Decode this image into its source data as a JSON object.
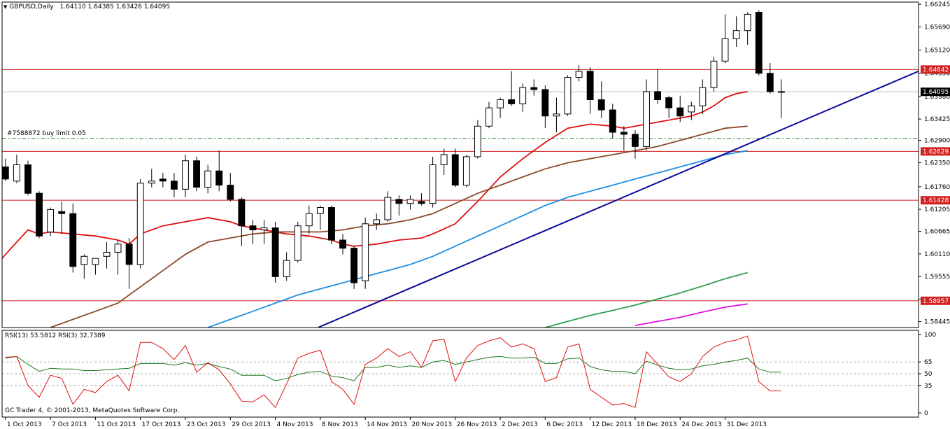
{
  "window": {
    "symbol_label": "GBPUSD,Daily",
    "ohlc_label": "1.64110 1.64385 1.63426 1.64095",
    "rsi_label": "RSI(13) 53.5812  RSI(3) 32.7389",
    "copyright": "GC Trader 4, © 2001-2013, MetaQuotes Software Corp."
  },
  "colors": {
    "candle_outline": "#000000",
    "bear_fill": "#000000",
    "bull_fill": "#ffffff",
    "ma_fast": "#e01010",
    "ma_mid": "#8b4a2b",
    "ma_slow": "#1e8fe0",
    "ma_200": "#2e9e50",
    "ma_300": "#e010e0",
    "trendline": "#0a0a9a",
    "level_line": "#d02020",
    "current_price_line": "#c0c0c0",
    "order_line": "#2a8a2a",
    "rsi_fast": "#e01010",
    "rsi_slow": "#1a7a1a"
  },
  "chart_data": {
    "type": "candlestick",
    "y_range": [
      1.583,
      1.663
    ],
    "x_range": [
      -0.3,
      81.2
    ],
    "grid": false,
    "price_ticks": [
      "1.66245",
      "1.65690",
      "1.65120",
      "1.64550",
      "1.63980",
      "1.63425",
      "1.62900",
      "1.62350",
      "1.61760",
      "1.61205",
      "1.60665",
      "1.60110",
      "1.59555",
      "1.59000",
      "1.58445"
    ],
    "date_ticks": [
      {
        "i": 0,
        "label": "1 Oct 2013"
      },
      {
        "i": 4,
        "label": "7 Oct 2013"
      },
      {
        "i": 8,
        "label": "11 Oct 2013"
      },
      {
        "i": 12,
        "label": "17 Oct 2013"
      },
      {
        "i": 16,
        "label": "23 Oct 2013"
      },
      {
        "i": 20,
        "label": "29 Oct 2013"
      },
      {
        "i": 24,
        "label": "4 Nov 2013"
      },
      {
        "i": 28,
        "label": "8 Nov 2013"
      },
      {
        "i": 32,
        "label": "14 Nov 2013"
      },
      {
        "i": 36,
        "label": "20 Nov 2013"
      },
      {
        "i": 40,
        "label": "26 Nov 2013"
      },
      {
        "i": 44,
        "label": "2 Dec 2013"
      },
      {
        "i": 48,
        "label": "6 Dec 2013"
      },
      {
        "i": 52,
        "label": "12 Dec 2013"
      },
      {
        "i": 56,
        "label": "18 Dec 2013"
      },
      {
        "i": 60,
        "label": "24 Dec 2013"
      },
      {
        "i": 64,
        "label": "31 Dec 2013"
      }
    ],
    "candles": [
      [
        1.6225,
        1.6245,
        1.619,
        1.6195
      ],
      [
        1.619,
        1.6255,
        1.6185,
        1.623
      ],
      [
        1.623,
        1.624,
        1.6155,
        1.616
      ],
      [
        1.616,
        1.6165,
        1.605,
        1.6055
      ],
      [
        1.6065,
        1.6125,
        1.6055,
        1.612
      ],
      [
        1.6115,
        1.614,
        1.606,
        1.611
      ],
      [
        1.611,
        1.6135,
        1.5965,
        1.598
      ],
      [
        1.5985,
        1.601,
        1.595,
        1.6005
      ],
      [
        1.5985,
        1.6,
        1.596,
        1.6
      ],
      [
        1.6005,
        1.604,
        1.5975,
        1.6015
      ],
      [
        1.6015,
        1.6045,
        1.596,
        1.6035
      ],
      [
        1.6035,
        1.605,
        1.5925,
        1.5985
      ],
      [
        1.5985,
        1.6195,
        1.5975,
        1.6185
      ],
      [
        1.6185,
        1.622,
        1.6175,
        1.619
      ],
      [
        1.6195,
        1.621,
        1.6175,
        1.619
      ],
      [
        1.619,
        1.621,
        1.615,
        1.617
      ],
      [
        1.617,
        1.6255,
        1.615,
        1.624
      ],
      [
        1.624,
        1.625,
        1.6165,
        1.6175
      ],
      [
        1.6175,
        1.623,
        1.616,
        1.6215
      ],
      [
        1.6215,
        1.6265,
        1.6165,
        1.618
      ],
      [
        1.618,
        1.621,
        1.614,
        1.6145
      ],
      [
        1.6145,
        1.615,
        1.603,
        1.608
      ],
      [
        1.608,
        1.6095,
        1.6035,
        1.607
      ],
      [
        1.607,
        1.6095,
        1.6035,
        1.6075
      ],
      [
        1.6075,
        1.609,
        1.594,
        1.5955
      ],
      [
        1.5955,
        1.6015,
        1.5945,
        1.5995
      ],
      [
        1.5995,
        1.609,
        1.599,
        1.608
      ],
      [
        1.608,
        1.613,
        1.606,
        1.611
      ],
      [
        1.611,
        1.613,
        1.607,
        1.6125
      ],
      [
        1.6125,
        1.613,
        1.6035,
        1.6045
      ],
      [
        1.6045,
        1.606,
        1.601,
        1.6025
      ],
      [
        1.6025,
        1.603,
        1.5925,
        1.594
      ],
      [
        1.5945,
        1.61,
        1.5925,
        1.6085
      ],
      [
        1.6085,
        1.611,
        1.607,
        1.6095
      ],
      [
        1.6095,
        1.6165,
        1.609,
        1.615
      ],
      [
        1.6145,
        1.6155,
        1.6105,
        1.6135
      ],
      [
        1.6135,
        1.6155,
        1.612,
        1.6145
      ],
      [
        1.614,
        1.616,
        1.613,
        1.6135
      ],
      [
        1.6135,
        1.625,
        1.6125,
        1.623
      ],
      [
        1.623,
        1.627,
        1.6205,
        1.6255
      ],
      [
        1.6255,
        1.627,
        1.6175,
        1.618
      ],
      [
        1.618,
        1.6255,
        1.6175,
        1.625
      ],
      [
        1.625,
        1.634,
        1.6245,
        1.6325
      ],
      [
        1.6325,
        1.6385,
        1.632,
        1.637
      ],
      [
        1.637,
        1.6395,
        1.6345,
        1.639
      ],
      [
        1.639,
        1.646,
        1.6375,
        1.638
      ],
      [
        1.638,
        1.643,
        1.636,
        1.642
      ],
      [
        1.642,
        1.644,
        1.64,
        1.6415
      ],
      [
        1.6415,
        1.6425,
        1.632,
        1.635
      ],
      [
        1.635,
        1.6395,
        1.631,
        1.6355
      ],
      [
        1.6355,
        1.645,
        1.635,
        1.6445
      ],
      [
        1.6445,
        1.6475,
        1.6435,
        1.646
      ],
      [
        1.646,
        1.647,
        1.6355,
        1.639
      ],
      [
        1.639,
        1.6435,
        1.6345,
        1.6365
      ],
      [
        1.6365,
        1.638,
        1.6295,
        1.631
      ],
      [
        1.631,
        1.6325,
        1.6265,
        1.6305
      ],
      [
        1.6305,
        1.6315,
        1.6245,
        1.6275
      ],
      [
        1.6275,
        1.644,
        1.6265,
        1.641
      ],
      [
        1.641,
        1.6465,
        1.638,
        1.639
      ],
      [
        1.6395,
        1.64,
        1.6345,
        1.637
      ],
      [
        1.637,
        1.64,
        1.6335,
        1.635
      ],
      [
        1.636,
        1.6385,
        1.634,
        1.6375
      ],
      [
        1.6375,
        1.644,
        1.6355,
        1.642
      ],
      [
        1.642,
        1.6495,
        1.641,
        1.6485
      ],
      [
        1.6485,
        1.66,
        1.648,
        1.654
      ],
      [
        1.654,
        1.6595,
        1.652,
        1.656
      ],
      [
        1.656,
        1.6605,
        1.6525,
        1.66
      ],
      [
        1.6605,
        1.661,
        1.645,
        1.6455
      ],
      [
        1.6455,
        1.648,
        1.6405,
        1.641
      ],
      [
        1.641,
        1.644,
        1.6345,
        1.641
      ]
    ],
    "moving_averages": [
      {
        "name": "ma_fast",
        "color_key": "ma_fast",
        "width": 1.8,
        "points": [
          [
            -0.3,
            1.6
          ],
          [
            1,
            1.604
          ],
          [
            2,
            1.607
          ],
          [
            3,
            1.606
          ],
          [
            4,
            1.6065
          ],
          [
            6,
            1.606
          ],
          [
            8,
            1.6055
          ],
          [
            10,
            1.6045
          ],
          [
            11,
            1.6035
          ],
          [
            12,
            1.606
          ],
          [
            14,
            1.608
          ],
          [
            16,
            1.609
          ],
          [
            18,
            1.61
          ],
          [
            20,
            1.609
          ],
          [
            21,
            1.608
          ],
          [
            23,
            1.607
          ],
          [
            25,
            1.606
          ],
          [
            27,
            1.6055
          ],
          [
            28,
            1.605
          ],
          [
            29,
            1.6045
          ],
          [
            30,
            1.6035
          ],
          [
            31,
            1.603
          ],
          [
            33,
            1.6035
          ],
          [
            35,
            1.6045
          ],
          [
            37,
            1.605
          ],
          [
            38,
            1.606
          ],
          [
            40,
            1.6085
          ],
          [
            42,
            1.614
          ],
          [
            44,
            1.62
          ],
          [
            46,
            1.6245
          ],
          [
            48,
            1.6285
          ],
          [
            50,
            1.632
          ],
          [
            52,
            1.633
          ],
          [
            54,
            1.6325
          ],
          [
            55,
            1.632
          ],
          [
            57,
            1.633
          ],
          [
            59,
            1.634
          ],
          [
            61,
            1.635
          ],
          [
            62,
            1.636
          ],
          [
            63,
            1.6375
          ],
          [
            64,
            1.6395
          ],
          [
            65,
            1.6405
          ],
          [
            66,
            1.641
          ]
        ]
      },
      {
        "name": "ma_mid",
        "color_key": "ma_mid",
        "width": 1.8,
        "points": [
          [
            4,
            1.583
          ],
          [
            6,
            1.585
          ],
          [
            8,
            1.587
          ],
          [
            10,
            1.589
          ],
          [
            12,
            1.593
          ],
          [
            14,
            1.597
          ],
          [
            16,
            1.601
          ],
          [
            18,
            1.604
          ],
          [
            20,
            1.605
          ],
          [
            22,
            1.606
          ],
          [
            24,
            1.6065
          ],
          [
            26,
            1.6065
          ],
          [
            28,
            1.6065
          ],
          [
            30,
            1.607
          ],
          [
            32,
            1.608
          ],
          [
            34,
            1.6085
          ],
          [
            36,
            1.6095
          ],
          [
            38,
            1.611
          ],
          [
            40,
            1.6135
          ],
          [
            42,
            1.616
          ],
          [
            44,
            1.618
          ],
          [
            46,
            1.62
          ],
          [
            48,
            1.622
          ],
          [
            50,
            1.6235
          ],
          [
            52,
            1.6245
          ],
          [
            54,
            1.6255
          ],
          [
            56,
            1.6265
          ],
          [
            58,
            1.6275
          ],
          [
            60,
            1.629
          ],
          [
            62,
            1.6305
          ],
          [
            64,
            1.632
          ],
          [
            66,
            1.6325
          ]
        ]
      },
      {
        "name": "ma_slow",
        "color_key": "ma_slow",
        "width": 1.8,
        "points": [
          [
            18,
            1.583
          ],
          [
            20,
            1.585
          ],
          [
            22,
            1.587
          ],
          [
            24,
            1.589
          ],
          [
            26,
            1.591
          ],
          [
            28,
            1.5925
          ],
          [
            30,
            1.594
          ],
          [
            32,
            1.5955
          ],
          [
            34,
            1.597
          ],
          [
            36,
            1.5985
          ],
          [
            38,
            1.6005
          ],
          [
            40,
            1.603
          ],
          [
            42,
            1.6055
          ],
          [
            44,
            1.608
          ],
          [
            46,
            1.6105
          ],
          [
            48,
            1.613
          ],
          [
            50,
            1.615
          ],
          [
            52,
            1.6165
          ],
          [
            54,
            1.618
          ],
          [
            56,
            1.6195
          ],
          [
            58,
            1.621
          ],
          [
            60,
            1.6225
          ],
          [
            62,
            1.624
          ],
          [
            64,
            1.6255
          ],
          [
            66,
            1.6265
          ]
        ]
      },
      {
        "name": "ma_200",
        "color_key": "ma_200",
        "width": 1.8,
        "points": [
          [
            48,
            1.583
          ],
          [
            50,
            1.5845
          ],
          [
            52,
            1.586
          ],
          [
            54,
            1.5872
          ],
          [
            56,
            1.5885
          ],
          [
            58,
            1.59
          ],
          [
            60,
            1.5915
          ],
          [
            62,
            1.5932
          ],
          [
            64,
            1.595
          ],
          [
            66,
            1.5965
          ]
        ]
      },
      {
        "name": "ma_300",
        "color_key": "ma_300",
        "width": 1.8,
        "points": [
          [
            56,
            1.5835
          ],
          [
            58,
            1.5845
          ],
          [
            60,
            1.5855
          ],
          [
            62,
            1.5868
          ],
          [
            64,
            1.588
          ],
          [
            66,
            1.5888
          ]
        ]
      }
    ],
    "trendline": {
      "points": [
        [
          27.8,
          1.583
        ],
        [
          81.2,
          1.646
        ]
      ],
      "color_key": "trendline"
    },
    "levels": [
      {
        "price": 1.64642,
        "label": "1.64642",
        "kind": "resistance"
      },
      {
        "price": 1.62629,
        "label": "1.62629",
        "kind": "resistance"
      },
      {
        "price": 1.61428,
        "label": "1.61428",
        "kind": "resistance"
      },
      {
        "price": 1.58957,
        "label": "1.58957",
        "kind": "resistance"
      }
    ],
    "current_price": {
      "price": 1.64095,
      "label": "1.64095"
    },
    "order_line": {
      "price": 1.6295,
      "label": "#7588872 buy limit 0.05"
    },
    "rsi": {
      "y_range": [
        0,
        100
      ],
      "ticks": [
        100,
        65,
        50,
        35,
        0
      ],
      "dashed_levels": [
        65,
        50,
        35
      ],
      "series": [
        {
          "name": "RSI(13)",
          "color_key": "rsi_slow",
          "values": [
            71,
            72,
            62,
            53,
            57,
            56,
            56,
            54,
            54,
            55,
            56,
            57,
            63,
            63,
            63,
            61,
            64,
            61,
            63,
            59,
            56,
            48,
            48,
            48,
            41,
            44,
            49,
            52,
            53,
            47,
            45,
            41,
            58,
            58,
            61,
            58,
            60,
            58,
            65,
            67,
            62,
            65,
            68,
            71,
            72,
            70,
            70,
            71,
            63,
            63,
            69,
            70,
            59,
            55,
            53,
            53,
            50,
            66,
            61,
            57,
            55,
            56,
            60,
            62,
            65,
            67,
            70,
            56,
            52,
            52
          ]
        },
        {
          "name": "RSI(3)",
          "color_key": "rsi_fast",
          "values": [
            70,
            72,
            35,
            20,
            48,
            44,
            11,
            30,
            26,
            40,
            48,
            28,
            90,
            90,
            82,
            68,
            86,
            52,
            64,
            55,
            37,
            15,
            14,
            23,
            7,
            37,
            70,
            76,
            80,
            40,
            30,
            11,
            62,
            70,
            82,
            72,
            78,
            58,
            92,
            94,
            40,
            70,
            86,
            92,
            96,
            84,
            88,
            82,
            40,
            45,
            84,
            88,
            30,
            20,
            10,
            12,
            7,
            78,
            62,
            46,
            40,
            50,
            72,
            84,
            90,
            93,
            98,
            40,
            28,
            28
          ]
        }
      ]
    }
  }
}
